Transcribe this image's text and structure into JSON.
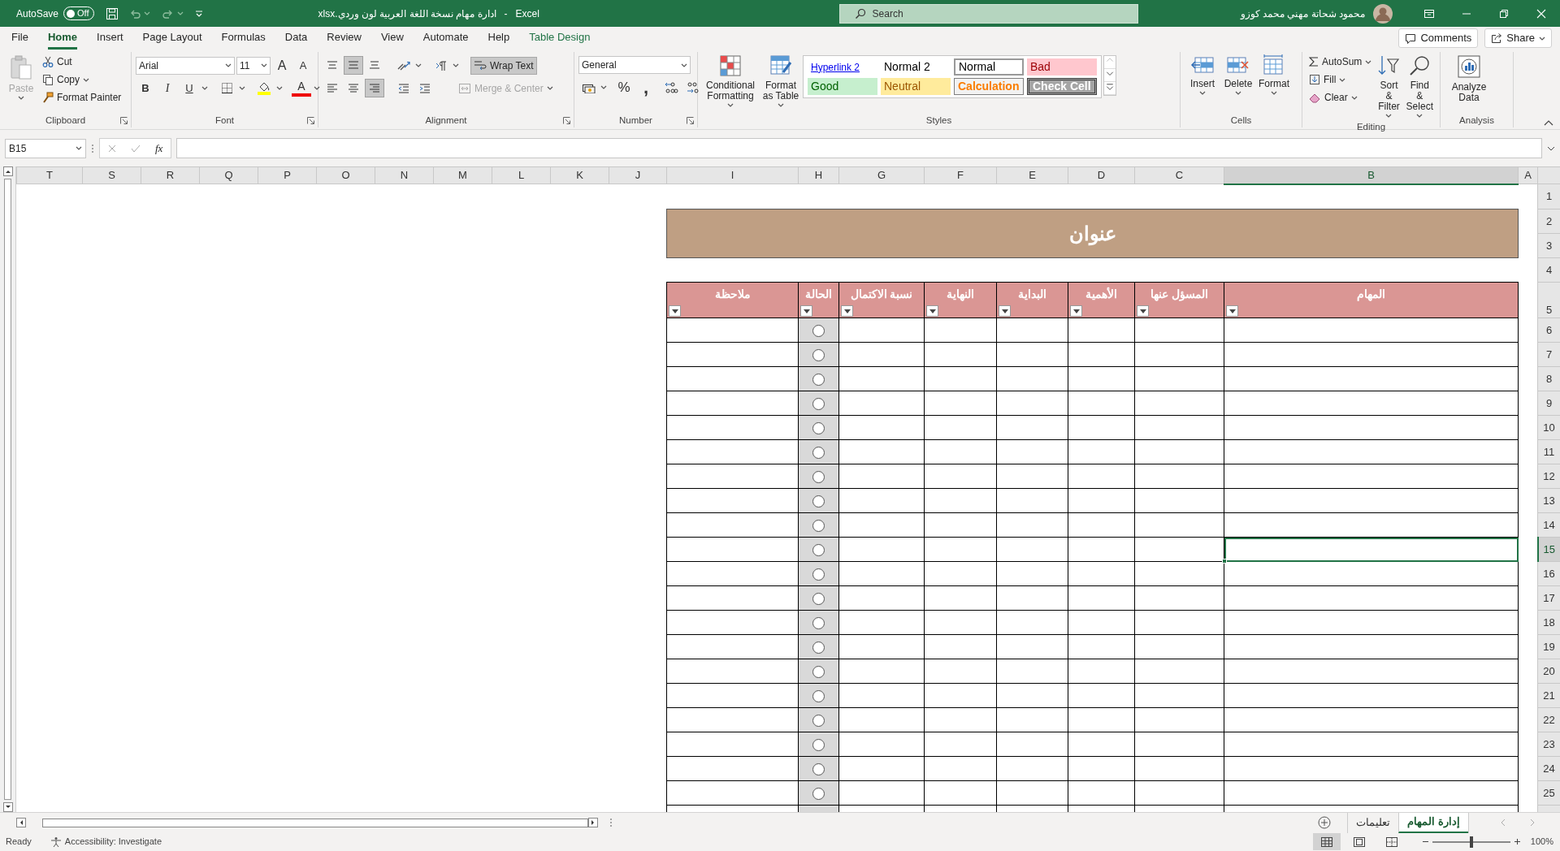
{
  "title_bar": {
    "autosave": {
      "label": "AutoSave",
      "state_text": "Off",
      "on": false
    },
    "file_name": "ادارة مهام نسخة اللغة العربية لون وردي.xlsx",
    "separator": "-",
    "app_name": "Excel",
    "search": {
      "placeholder": "Search"
    },
    "user_name": "محمود شحاتة مهني محمد كوزو"
  },
  "ribbon_tabs": [
    {
      "label": "File",
      "selected": false,
      "kind": "normal"
    },
    {
      "label": "Home",
      "selected": true,
      "kind": "normal"
    },
    {
      "label": "Insert",
      "selected": false,
      "kind": "normal"
    },
    {
      "label": "Page Layout",
      "selected": false,
      "kind": "normal"
    },
    {
      "label": "Formulas",
      "selected": false,
      "kind": "normal"
    },
    {
      "label": "Data",
      "selected": false,
      "kind": "normal"
    },
    {
      "label": "Review",
      "selected": false,
      "kind": "normal"
    },
    {
      "label": "View",
      "selected": false,
      "kind": "normal"
    },
    {
      "label": "Automate",
      "selected": false,
      "kind": "normal"
    },
    {
      "label": "Help",
      "selected": false,
      "kind": "normal"
    },
    {
      "label": "Table Design",
      "selected": false,
      "kind": "contextual"
    }
  ],
  "comments_button": "Comments",
  "share_button": "Share",
  "ribbon": {
    "clipboard": {
      "title": "Clipboard",
      "paste": {
        "label": "Paste",
        "disabled": true
      },
      "cut": "Cut",
      "copy": "Copy",
      "format_painter": "Format Painter"
    },
    "font": {
      "title": "Font",
      "font_name": "Arial",
      "font_size": "11",
      "grow": "A",
      "shrink": "A",
      "bold": "B",
      "italic": "I",
      "underline": "U",
      "font_color": "A"
    },
    "alignment": {
      "title": "Alignment",
      "buttons": [
        {
          "selected": false
        },
        {
          "selected": true
        },
        {
          "selected": false
        },
        {
          "selected": false
        },
        {
          "selected": false
        },
        {
          "selected": true
        }
      ],
      "wrap_text": {
        "label": "Wrap Text",
        "on": true
      },
      "merge": {
        "label": "Merge & Center",
        "disabled": true
      }
    },
    "number": {
      "title": "Number",
      "format": "General",
      "percent": "%",
      "comma": ","
    },
    "styles": {
      "title": "Styles",
      "conditional_formatting": "Conditional Formatting",
      "format_as_table": "Format as Table",
      "cell_styles": [
        {
          "label": "Hyperlink 2",
          "kind": "hyperlink"
        },
        {
          "label": "Normal 2",
          "kind": "plain"
        },
        {
          "label": "Normal",
          "kind": "normal"
        },
        {
          "label": "Bad",
          "kind": "bad"
        },
        {
          "label": "Good",
          "kind": "good"
        },
        {
          "label": "Neutral",
          "kind": "neutral"
        },
        {
          "label": "Calculation",
          "kind": "calculation"
        },
        {
          "label": "Check Cell",
          "kind": "check"
        }
      ]
    },
    "cells": {
      "title": "Cells",
      "buttons": [
        "Insert",
        "Delete",
        "Format"
      ]
    },
    "editing": {
      "title": "Editing",
      "autosum": "AutoSum",
      "fill": "Fill",
      "clear": "Clear",
      "sort_filter": "Sort & Filter",
      "find_select": "Find & Select"
    },
    "analysis": {
      "title": "Analysis",
      "analyze_data": "Analyze Data"
    }
  },
  "formula_bar": {
    "name_box": "B15",
    "fx": "fx"
  },
  "column_headers": [
    {
      "label": "T",
      "selected": false
    },
    {
      "label": "S",
      "selected": false
    },
    {
      "label": "R",
      "selected": false
    },
    {
      "label": "Q",
      "selected": false
    },
    {
      "label": "P",
      "selected": false
    },
    {
      "label": "O",
      "selected": false
    },
    {
      "label": "N",
      "selected": false
    },
    {
      "label": "M",
      "selected": false
    },
    {
      "label": "L",
      "selected": false
    },
    {
      "label": "K",
      "selected": false
    },
    {
      "label": "J",
      "selected": false
    },
    {
      "label": "I",
      "selected": false
    },
    {
      "label": "H",
      "selected": false
    },
    {
      "label": "G",
      "selected": false
    },
    {
      "label": "F",
      "selected": false
    },
    {
      "label": "E",
      "selected": false
    },
    {
      "label": "D",
      "selected": false
    },
    {
      "label": "C",
      "selected": false
    },
    {
      "label": "B",
      "selected": true
    },
    {
      "label": "A",
      "selected": false
    }
  ],
  "row_headers": [
    {
      "label": "1",
      "selected": false
    },
    {
      "label": "2",
      "selected": false
    },
    {
      "label": "3",
      "selected": false
    },
    {
      "label": "4",
      "selected": false
    },
    {
      "label": "5",
      "selected": false
    },
    {
      "label": "6",
      "selected": false
    },
    {
      "label": "7",
      "selected": false
    },
    {
      "label": "8",
      "selected": false
    },
    {
      "label": "9",
      "selected": false
    },
    {
      "label": "10",
      "selected": false
    },
    {
      "label": "11",
      "selected": false
    },
    {
      "label": "12",
      "selected": false
    },
    {
      "label": "13",
      "selected": false
    },
    {
      "label": "14",
      "selected": false
    },
    {
      "label": "15",
      "selected": true
    },
    {
      "label": "16",
      "selected": false
    },
    {
      "label": "17",
      "selected": false
    },
    {
      "label": "18",
      "selected": false
    },
    {
      "label": "19",
      "selected": false
    },
    {
      "label": "20",
      "selected": false
    },
    {
      "label": "21",
      "selected": false
    },
    {
      "label": "22",
      "selected": false
    },
    {
      "label": "23",
      "selected": false
    },
    {
      "label": "24",
      "selected": false
    },
    {
      "label": "25",
      "selected": false
    }
  ],
  "sheet": {
    "title": "عنوان",
    "table": {
      "columns": [
        {
          "label": "المهام",
          "kind": "text"
        },
        {
          "label": "المسؤل عنها",
          "kind": "text"
        },
        {
          "label": "الأهمية",
          "kind": "text"
        },
        {
          "label": "البداية",
          "kind": "text"
        },
        {
          "label": "النهاية",
          "kind": "text"
        },
        {
          "label": "نسبة الاكتمال",
          "kind": "text"
        },
        {
          "label": "الحالة",
          "kind": "option"
        },
        {
          "label": "ملاحظة",
          "kind": "text"
        }
      ],
      "rows": [
        {
          "selected": false
        },
        {
          "selected": false
        },
        {
          "selected": false
        },
        {
          "selected": false
        },
        {
          "selected": false
        },
        {
          "selected": false
        },
        {
          "selected": false
        },
        {
          "selected": false
        },
        {
          "selected": false
        },
        {
          "selected": false
        },
        {
          "selected": false
        },
        {
          "selected": false
        },
        {
          "selected": false
        },
        {
          "selected": false
        },
        {
          "selected": false
        },
        {
          "selected": false
        },
        {
          "selected": false
        },
        {
          "selected": false
        },
        {
          "selected": false
        },
        {
          "selected": false
        }
      ]
    }
  },
  "sheet_tabs": [
    {
      "label": "إدارة المهام",
      "selected": true
    },
    {
      "label": "تعليمات",
      "selected": false
    }
  ],
  "status_bar": {
    "ready": "Ready",
    "accessibility": "Accessibility: Investigate",
    "views": [
      {
        "selected": true
      },
      {
        "selected": false
      },
      {
        "selected": false
      }
    ],
    "zoom": {
      "level": 0.5,
      "label": "100%"
    }
  }
}
